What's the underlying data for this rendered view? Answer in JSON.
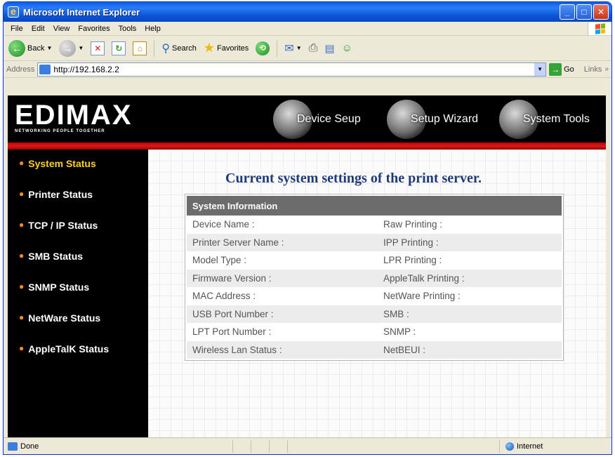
{
  "window": {
    "title": "Microsoft Internet Explorer"
  },
  "menu": [
    "File",
    "Edit",
    "View",
    "Favorites",
    "Tools",
    "Help"
  ],
  "toolbar": {
    "back_label": "Back",
    "search_label": "Search",
    "favorites_label": "Favorites"
  },
  "address": {
    "label": "Address",
    "url": "http://192.168.2.2",
    "go_label": "Go",
    "links_label": "Links"
  },
  "banner": {
    "logo_text": "EDIMAX",
    "logo_tagline": "NETWORKING PEOPLE TOGETHER",
    "nav": [
      "Device Seup",
      "Setup Wizard",
      "System Tools"
    ]
  },
  "sidebar": {
    "items": [
      {
        "label": "System Status",
        "active": true
      },
      {
        "label": "Printer Status"
      },
      {
        "label": "TCP / IP Status"
      },
      {
        "label": "SMB Status"
      },
      {
        "label": "SNMP Status"
      },
      {
        "label": "NetWare Status"
      },
      {
        "label": "AppleTalK Status"
      }
    ]
  },
  "main": {
    "heading": "Current system settings of the print server.",
    "table_header": "System Information",
    "rows": [
      [
        "Device Name :",
        "Raw Printing :"
      ],
      [
        "Printer Server Name :",
        "IPP Printing :"
      ],
      [
        "Model Type :",
        "LPR Printing :"
      ],
      [
        "Firmware Version :",
        "AppleTalk Printing :"
      ],
      [
        "MAC Address :",
        "NetWare Printing :"
      ],
      [
        "USB Port Number :",
        "SMB :"
      ],
      [
        "LPT Port Number :",
        "SNMP :"
      ],
      [
        "Wireless Lan Status :",
        "NetBEUI :"
      ]
    ]
  },
  "status": {
    "text": "Done",
    "zone": "Internet"
  },
  "colors": {
    "accent_red": "#e01818",
    "heading_blue": "#1e3a7a",
    "active_item": "#ffd21e",
    "bullet": "#ff8c1a"
  }
}
